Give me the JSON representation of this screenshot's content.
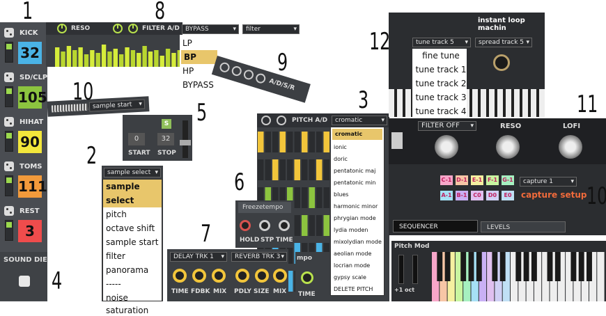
{
  "callouts": [
    "1",
    "2",
    "3",
    "4",
    "5",
    "6",
    "7",
    "8",
    "9",
    "10",
    "10",
    "10",
    "11",
    "12"
  ],
  "tracks": [
    {
      "name": "KICK",
      "value": "32",
      "color": "#4ab3e6"
    },
    {
      "name": "SD/CLP",
      "value": "105",
      "color": "#8cc43f"
    },
    {
      "name": "HIHAT",
      "value": "90",
      "color": "#f2e63b"
    },
    {
      "name": "TOMS",
      "value": "111",
      "color": "#f29a3b"
    },
    {
      "name": "REST",
      "value": "3",
      "color": "#ef4c4c"
    }
  ],
  "sound_die": {
    "label": "SOUND DIE"
  },
  "reso": {
    "label": "RESO",
    "filter_label": "FILTER A/D",
    "filter_type_dropdown": "BYPASS",
    "filter_dropdown": "filter",
    "bar_levels": [
      0.7,
      0.55,
      0.75,
      0.6,
      0.7,
      0.45,
      0.6,
      0.5,
      0.8,
      0.55,
      0.65,
      0.45,
      0.7,
      0.6,
      0.5,
      0.75,
      0.55,
      0.6,
      0.4,
      0.65,
      0.5,
      0.6
    ]
  },
  "filter_type_popup": {
    "items": [
      "LP",
      "BP",
      "HP",
      "BYPASS"
    ],
    "selected": "BP"
  },
  "adsr": {
    "label": "A/D/S/R"
  },
  "sample_start_strip": {
    "dropdown": "sample start"
  },
  "start_stop": {
    "start_value": "0",
    "start_label": "START",
    "stop_value": "32",
    "stop_label": "STOP",
    "s_label": "S"
  },
  "sample_select_popup": {
    "dropdown": "sample select",
    "items": [
      "sample select",
      "pitch",
      "octave shift",
      "sample start",
      "filter",
      "panorama",
      "-----",
      "noise",
      "saturation"
    ],
    "selected": "sample select"
  },
  "pitch": {
    "label": "PITCH A/D",
    "dropdown": "cromatic",
    "scale_items": [
      "cromatic",
      "ionic",
      "doric",
      "pentatonic maj",
      "pentatonic min",
      "blues",
      "harmonic minor",
      "phrygian mode",
      "lydia moden",
      "mixolydian mode",
      "aeolian mode",
      "locrian mode",
      "gypsy scale",
      "DELETE PITCH"
    ],
    "selected": "cromatic"
  },
  "freeze": {
    "tab": "Freezetempo",
    "knobs": [
      "HOLD",
      "STP",
      "TIME"
    ],
    "tab2": "mpo",
    "time": "TIME"
  },
  "fx": {
    "delay_dropdown": "DELAY TRK 1",
    "reverb_dropdown": "REVERB TRK 3",
    "delay_knobs": [
      "TIME",
      "FDBK",
      "MIX"
    ],
    "reverb_knobs": [
      "PDLY",
      "SIZE",
      "MIX"
    ]
  },
  "instant": {
    "title": "instant loop machin",
    "tune_dropdown": "tune track 5",
    "spread_dropdown": "spread track 5",
    "tune_items": [
      "fine tune",
      "tune track 1",
      "tune track 2",
      "tune track 3",
      "tune track 4"
    ]
  },
  "fx_rack": {
    "filter_off": "FILTER OFF",
    "reso": "RESO",
    "lofi": "LOFI",
    "notes": [
      {
        "label": "C-1",
        "color": "#f7a6c9"
      },
      {
        "label": "D-1",
        "color": "#f7c6a6"
      },
      {
        "label": "E-1",
        "color": "#f5f0a0"
      },
      {
        "label": "F-1",
        "color": "#c9f5a0"
      },
      {
        "label": "G-1",
        "color": "#a6f0c0"
      },
      {
        "label": "A-1",
        "color": "#a6e0f5"
      },
      {
        "label": "B-1",
        "color": "#c9b0f5"
      },
      {
        "label": "C0",
        "color": "#e0c0f0"
      },
      {
        "label": "D0",
        "color": "#d0d0f5"
      },
      {
        "label": "E0",
        "color": "#c0e0f5"
      }
    ],
    "capture_dropdown": "capture 1",
    "capture_setup": "capture setup",
    "sequencer": "SEQUENCER",
    "levels": "LEVELS"
  },
  "keyboard": {
    "label": "Pitch Mod",
    "oct": "+1 oct"
  }
}
